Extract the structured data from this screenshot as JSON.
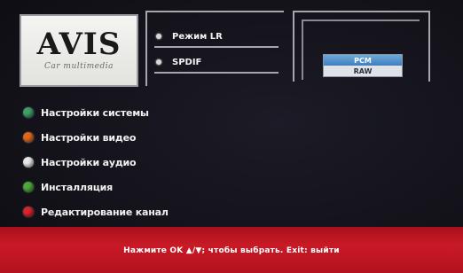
{
  "logo": {
    "brand": "AVIS",
    "tagline": "Car multimedia"
  },
  "menu": {
    "items": [
      {
        "label": "Настройки системы",
        "color": "#3fa06a",
        "icon": "green-dot-icon"
      },
      {
        "label": "Настройки видео",
        "color": "#e06a1c",
        "icon": "orange-dot-icon"
      },
      {
        "label": "Настройки аудио",
        "color": "#e8e8e8",
        "icon": "white-dot-icon"
      },
      {
        "label": "Инсталляция",
        "color": "#4caa3a",
        "icon": "green-dot-icon"
      },
      {
        "label": "Редактирование канал",
        "color": "#d8262c",
        "icon": "red-dot-icon"
      }
    ]
  },
  "options": {
    "items": [
      {
        "label": "Режим LR"
      },
      {
        "label": "SPDIF"
      }
    ]
  },
  "value_box": {
    "selected": "PCM",
    "other": "RAW",
    "highlight_color": "#4f8fcf"
  },
  "footer": {
    "hint": "Нажмите OK ▲/▼; чтобы выбрать. Exit: выйти",
    "color": "#c01824"
  }
}
